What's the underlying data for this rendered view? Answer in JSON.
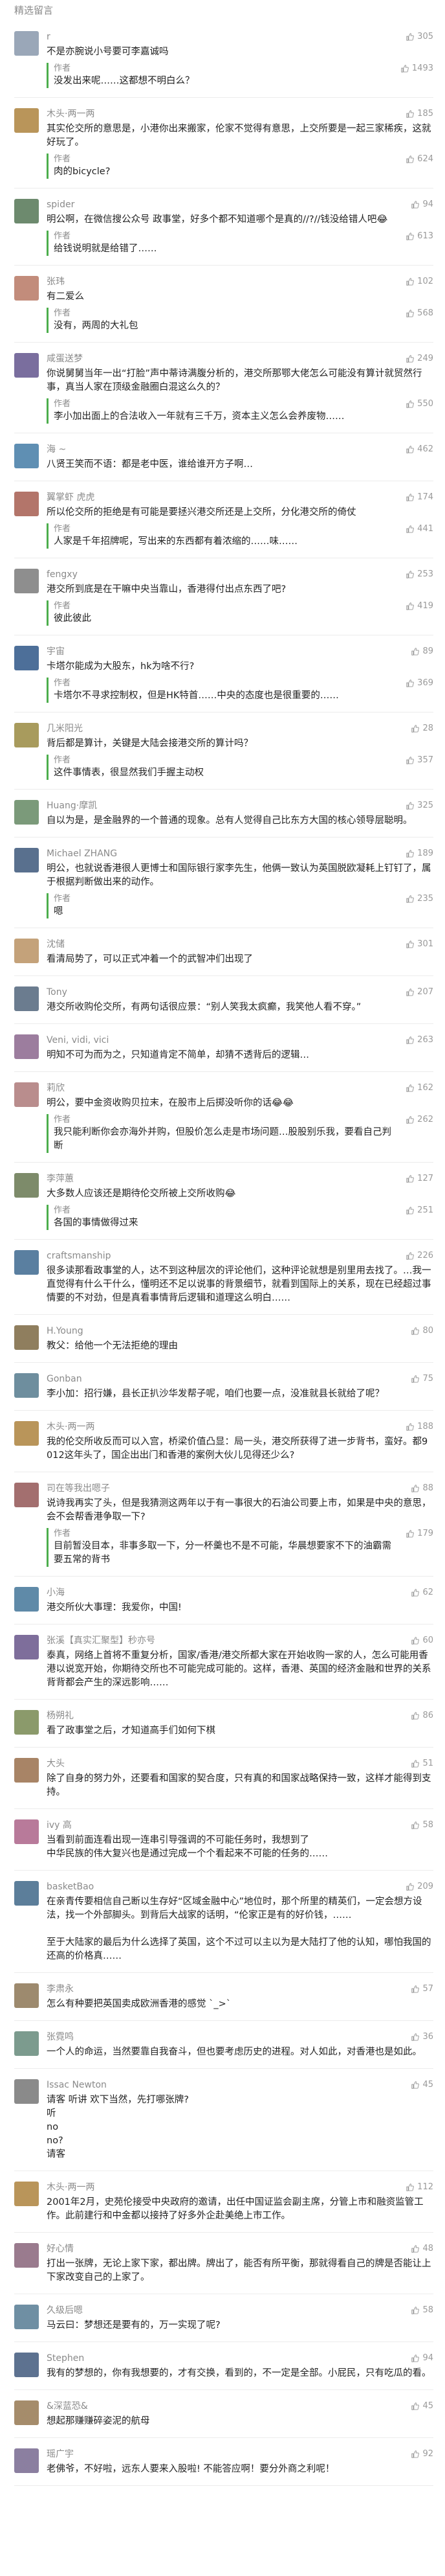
{
  "header": {
    "title": "精选留言"
  },
  "author_tag": "作者",
  "comments": [
    {
      "name": "r",
      "likes": "305",
      "text": "不是亦腕说小号要可李嘉诚吗",
      "reply": "没发出来呢……这都想不明白么？",
      "reply_likes": "1493",
      "color": "#9aa7b8"
    },
    {
      "name": "木头·两一两",
      "likes": "185",
      "text": "其实伦交所的意思是，小港你出来搬家，伦家不觉得有意思，上交所要是一起三家稀疾，这就好玩了。",
      "reply": "肉的bicycle?",
      "reply_likes": "624",
      "color": "#b9955a"
    },
    {
      "name": "spider",
      "likes": "94",
      "text": "明公啊，在微信搜公众号 政事堂，好多个都不知道哪个是真的//?//钱没给错人吧😂",
      "reply": "给钱说明就是给错了……",
      "reply_likes": "613",
      "color": "#6d8a6e"
    },
    {
      "name": "张玮",
      "likes": "102",
      "text": "有二爱么",
      "reply": "没有，两周的大礼包",
      "reply_likes": "568",
      "color": "#c28c7b"
    },
    {
      "name": "咸蛋送梦",
      "likes": "249",
      "text": "你说舅舅当年一出“打脸”声中蒂诗满腹分析的，港交所那鄂大佬怎么可能没有算计就贸然行事，真当人家在顶级金融圈白混这么久的？",
      "reply": "李小加出面上的合法收入一年就有三千万，资本主义怎么会养废物……",
      "reply_likes": "550",
      "color": "#7a6e9e"
    },
    {
      "name": "海 ~",
      "likes": "462",
      "text": "八贤王笑而不语：都是老中医，谁给谁开方子啊…",
      "reply": "",
      "reply_likes": "",
      "color": "#5f8fb3"
    },
    {
      "name": "翼掌虾 虎虎",
      "likes": "174",
      "text": "所以伦交所的拒绝是有可能是要拯兴港交所还是上交所，分化港交所的倚仗",
      "reply": "人家是千年招牌呢，写出来的东西都有着浓缩的……味……",
      "reply_likes": "441",
      "color": "#b3756a"
    },
    {
      "name": "fengxy",
      "likes": "253",
      "text": "港交所到底是在干嘛中央当靠山，香港得付出点东西了吧?",
      "reply": "彼此彼此",
      "reply_likes": "419",
      "color": "#8e8e8e"
    },
    {
      "name": "宇宙",
      "likes": "89",
      "text": "卡塔尔能成为大股东，hk为啥不行?",
      "reply": "卡塔尔不寻求控制权，但是HK特首……中央的态度也是很重要的……",
      "reply_likes": "369",
      "color": "#4d6f99"
    },
    {
      "name": "几米阳光",
      "likes": "28",
      "text": "背后都是算计，关键是大陆会接港交所的算计吗？",
      "reply": "这件事情表，很显然我们手握主动权",
      "reply_likes": "357",
      "color": "#a89b5d"
    },
    {
      "name": "Huang·摩凯",
      "likes": "325",
      "text": "自以为是，是金融界的一个普通的现象。总有人觉得自己比东方大国的核心领导层聪明。",
      "reply": "",
      "reply_likes": "",
      "color": "#7b9a7a"
    },
    {
      "name": "Michael ZHANG",
      "likes": "189",
      "text": "明公，也就说香港很人更博士和国际银行家李先生，他俩一致认为英国脱欧凝耗上钉钉了，属于根据判断做出来的动作。",
      "reply": "嗯",
      "reply_likes": "235",
      "color": "#59708e"
    },
    {
      "name": "沈储",
      "likes": "301",
      "text": "看清局势了，可以正式冲着一个的武智冲们出现了",
      "reply": "",
      "reply_likes": "",
      "color": "#c4a27a"
    },
    {
      "name": "Tony",
      "likes": "207",
      "text": "港交所收购伦交所，有两句话很应景：“别人笑我太疯癫，我笑他人看不穿。”",
      "reply": "",
      "reply_likes": "",
      "color": "#6b7c8f"
    },
    {
      "name": "Veni, vidi, vici",
      "likes": "263",
      "text": "明知不可为而为之，只知道肯定不简单，却猜不透背后的逻辑…",
      "reply": "",
      "reply_likes": "",
      "color": "#9c7d9e"
    },
    {
      "name": "莉欣",
      "likes": "162",
      "text": "明公，要中金资收购贝拉末，在股市上后掷没听你的话😂😂",
      "reply": "我只能利断你会亦海外并购，但股价怎么走是市场问题…股股别乐我，要看自己判断",
      "reply_likes": "262",
      "color": "#b98d8d"
    },
    {
      "name": "李萍蕙",
      "likes": "127",
      "text": "大多数人应该还是期待伦交所被上交所收购😂",
      "reply": "各国的事情做得过来",
      "reply_likes": "251",
      "color": "#7d8b6a"
    },
    {
      "name": "craftsmanship",
      "likes": "226",
      "text": "很多读那看政事堂的人，达不到这种层次的评论他们，这种评论就想是别里用去找了。…我一直觉得有什么干什么，懂明还不足以说事的背景细节，就看到国际上的关系，现在已经超过事情要的不对劲，但是真看事情背后逻辑和道理这么明白……",
      "reply": "",
      "reply_likes": "",
      "color": "#5a7fa0"
    },
    {
      "name": "H.Young",
      "likes": "80",
      "text": "教父：给他一个无法拒绝的理由",
      "reply": "",
      "reply_likes": "",
      "color": "#8f7e5e"
    },
    {
      "name": "Gonban",
      "likes": "75",
      "text": "李小加：招行嫌，县长正扒沙华发帮子呢，咱们也要一点，没准就县长就给了呢？",
      "reply": "",
      "reply_likes": "",
      "color": "#6e8e9e"
    },
    {
      "name": "木头·两一两",
      "likes": "188",
      "text": "我的伦交所收反而可以入宫，桥梁价值凸显：局一头，港交所获得了进一步背书，蛮好。都9012这年头了，国企出出门和香港的案例大伙儿见得还少么?",
      "reply": "",
      "reply_likes": "",
      "color": "#b9955a"
    },
    {
      "name": "司在等我出嗯子",
      "likes": "88",
      "text": "说诗我再实了头，但是我猜测这两年以于有一事很大的石油公司要上市，如果是中央的意思，会不会帮香港争取一下?",
      "reply": "目前暂没目本，非事多取一下，分一杯羹也不是不可能，华晨想要家不下的油霸需要五常的背书",
      "reply_likes": "179",
      "color": "#a36f6f"
    },
    {
      "name": "小海",
      "likes": "62",
      "text": "港交所伙大事理：我爱你，中国!",
      "reply": "",
      "reply_likes": "",
      "color": "#5f8aa8"
    },
    {
      "name": "张溪【真实汇聚型】秒亦号",
      "likes": "60",
      "text": "泰真，网络上首将不重复分析，国家/香港/港交所都大家在开始收购一家的人，怎么可能用香港以说宽开始，你期待交所也不可能完成可能的。这样，香港、英国的经济金融和世界的关系背背都会产生的深远影响……",
      "reply": "",
      "reply_likes": "",
      "color": "#7e6e9b"
    },
    {
      "name": "杨朔礼",
      "likes": "86",
      "text": "看了政事堂之后，才知道高手们如何下棋",
      "reply": "",
      "reply_likes": "",
      "color": "#8b9a6b"
    },
    {
      "name": "大头",
      "likes": "51",
      "text": "除了自身的努力外，还要看和国家的契合度，只有真的和国家战略保持一致，这样才能得到支持。",
      "reply": "",
      "reply_likes": "",
      "color": "#a88466"
    },
    {
      "name": "ivy 高",
      "likes": "58",
      "text": "当看到前面连看出现一连串引导强调的不可能任务时，我想到了\n中华民族的伟大复兴也是通过完成一个个看起来不可能的任务的……",
      "reply": "",
      "reply_likes": "",
      "color": "#b87a9a"
    },
    {
      "name": "basketBao",
      "likes": "209",
      "text": "在亲青传要相信自己断以生存好“区域金融中心”地位时，那个所里的精英们，一定会想方设法，找一个外部脚头。到背后大战家的话明，“伦家正是有的好价钱，……\n\n至于大陆家的最后为什么选择了英国，这个不过可以主以为是大陆打了他的认知，哪怕我国的还高的价格真……",
      "reply": "",
      "reply_likes": "",
      "color": "#5c7e9a"
    },
    {
      "name": "李肃永",
      "likes": "57",
      "text": "怎么有种要把英国卖成欧洲香港的感觉 `_>`",
      "reply": "",
      "reply_likes": "",
      "color": "#9d8a6e"
    },
    {
      "name": "张霓鸣",
      "likes": "36",
      "text": "一个人的命运，当然要靠自我奋斗，但也要考虑历史的进程。对人如此，对香港也是如此。",
      "reply": "",
      "reply_likes": "",
      "color": "#7c9b8e"
    },
    {
      "name": "Issac Newton",
      "likes": "45",
      "text": "请客 听讲 欢下当然，先打哪张牌?\n听\nno\nno?\n请客",
      "reply": "",
      "reply_likes": "",
      "color": "#8a8a8a"
    },
    {
      "name": "木头·两一两",
      "likes": "112",
      "text": "2001年2月，史苑伦接受中央政府的邀请，出任中国证监会副主席，分管上市和融资监管工作。此前建行和中金都以接持了好多外企赴美绝上市工作。",
      "reply": "",
      "reply_likes": "",
      "color": "#b9955a"
    },
    {
      "name": "好心情",
      "likes": "48",
      "text": "打出一张牌，无论上家下家，都出牌。牌出了，能否有所平衡，那就得看自己的牌是否能让上下家改变自己的上家了。",
      "reply": "",
      "reply_likes": "",
      "color": "#9a7b8e"
    },
    {
      "name": "久级后嗯",
      "likes": "58",
      "text": "马云曰：梦想还是要有的，万一实现了呢?",
      "reply": "",
      "reply_likes": "",
      "color": "#6f8fa3"
    },
    {
      "name": "Stephen",
      "likes": "94",
      "text": "我有的梦想的，你有我想要的，才有交换，看到的，不一定是全部。小屁民，只有吃瓜的看。",
      "reply": "",
      "reply_likes": "",
      "color": "#5d7290"
    },
    {
      "name": "&深蓝恐&",
      "likes": "45",
      "text": "想起那赚赚碎姿泥的航母",
      "reply": "",
      "reply_likes": "",
      "color": "#a58c6b"
    },
    {
      "name": "瑶广宇",
      "likes": "92",
      "text": "老佛爷，不好啦，远东人要来入股啦! 不能答应啊！要分外商之利呢！",
      "reply": "",
      "reply_likes": "",
      "color": "#8b7fa0"
    }
  ]
}
